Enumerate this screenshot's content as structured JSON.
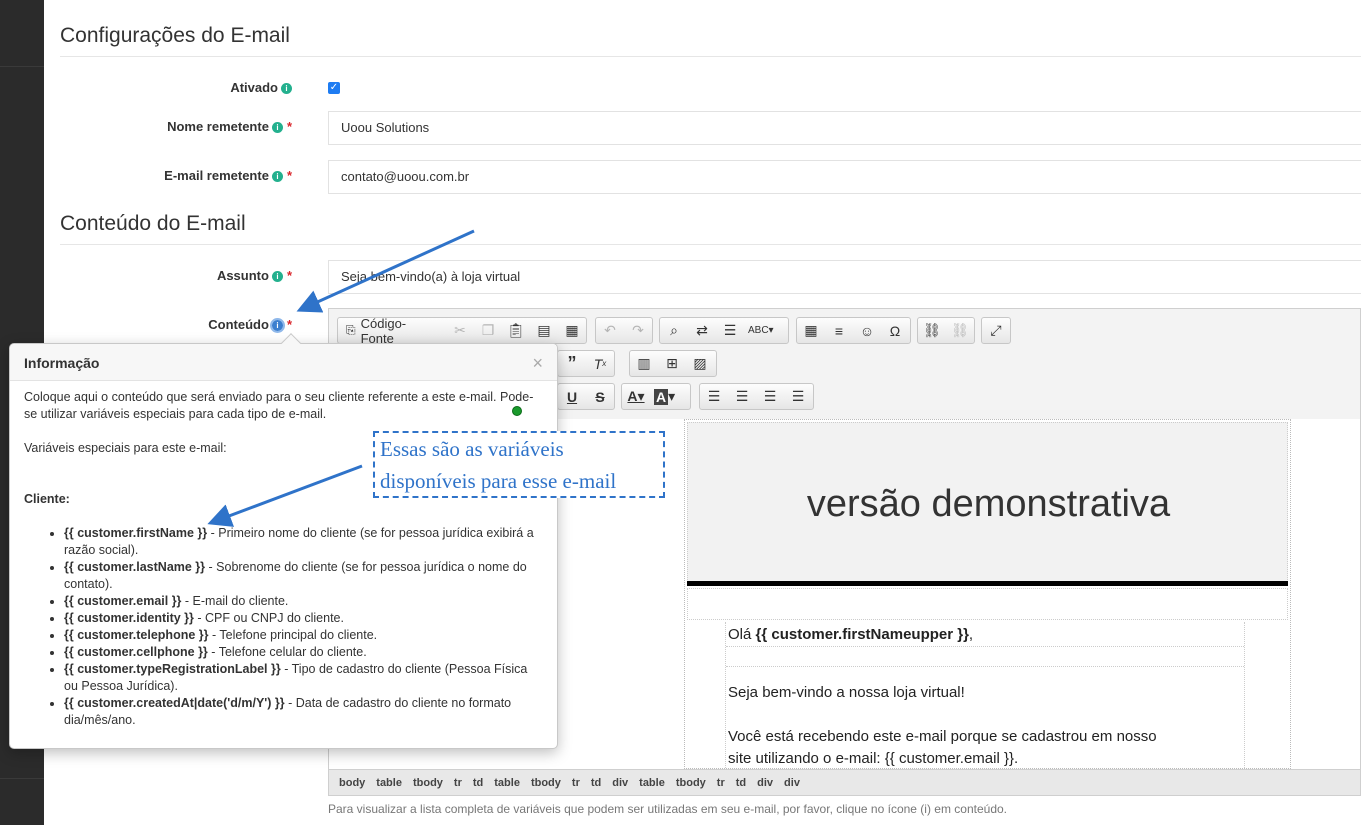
{
  "sections": {
    "config_title": "Configurações do E-mail",
    "content_title": "Conteúdo do E-mail"
  },
  "fields": {
    "enabled_label": "Ativado",
    "enabled_checked": true,
    "sender_name_label": "Nome remetente",
    "sender_name_value": "Uoou Solutions",
    "sender_email_label": "E-mail remetente",
    "sender_email_value": "contato@uoou.com.br",
    "subject_label": "Assunto",
    "subject_value": "Seja bem-vindo(a) à loja virtual",
    "content_label": "Conteúdo",
    "required_mark": "*",
    "info_glyph": "i"
  },
  "editor": {
    "source_button": "Código-Fonte",
    "toolbar_icons": [
      "source-icon",
      "cut-icon",
      "copy-icon",
      "paste-icon",
      "paste-text-icon",
      "paste-word-icon",
      "undo-icon",
      "redo-icon",
      "find-icon",
      "replace-icon",
      "select-all-icon",
      "spellcheck-icon",
      "table-icon",
      "horizontal-line-icon",
      "smiley-icon",
      "special-char-icon",
      "link-icon",
      "unlink-icon",
      "maximize-icon",
      "blockquote-icon",
      "remove-format-icon",
      "media-icon",
      "template-icon",
      "image-icon",
      "underline-icon",
      "strikethrough-icon",
      "text-color-icon",
      "bg-color-icon",
      "align-left-icon",
      "align-center-icon",
      "align-right-icon",
      "justify-icon"
    ],
    "brand_text": "versão demonstrativa",
    "greeting_prefix": "Olá ",
    "greeting_var": "{{ customer.firstNameupper }}",
    "greeting_suffix": ",",
    "welcome_line": "Seja bem-vindo a nossa loja virtual!",
    "body_line1": "Você está recebendo este e-mail porque se cadastrou em nosso",
    "body_line2_prefix": "site utilizando o e-mail: {{ ",
    "body_line2_var": "customer.email",
    "body_line2_suffix": " }}.",
    "path": [
      "body",
      "table",
      "tbody",
      "tr",
      "td",
      "table",
      "tbody",
      "tr",
      "td",
      "div",
      "table",
      "tbody",
      "tr",
      "td",
      "div",
      "div"
    ],
    "help_text": "Para visualizar a lista completa de variáveis que podem ser utilizadas em seu e-mail, por favor, clique no ícone (i) em conteúdo."
  },
  "popover": {
    "title": "Informação",
    "close": "×",
    "intro": "Coloque aqui o conteúdo que será enviado para o seu cliente referente a este e-mail. Pode-se utilizar variáveis especiais para cada tipo de e-mail.",
    "vars_heading": "Variáveis especiais para este e-mail:",
    "group_title": "Cliente:",
    "items": [
      {
        "var": "{{ customer.firstName }}",
        "desc": " - Primeiro nome do cliente (se for pessoa jurídica exibirá a razão social)."
      },
      {
        "var": "{{ customer.lastName }}",
        "desc": " - Sobrenome do cliente (se for pessoa jurídica o nome do contato)."
      },
      {
        "var": "{{ customer.email }}",
        "desc": " - E-mail do cliente."
      },
      {
        "var": "{{ customer.identity }}",
        "desc": " - CPF ou CNPJ do cliente."
      },
      {
        "var": "{{ customer.telephone }}",
        "desc": " - Telefone principal do cliente."
      },
      {
        "var": "{{ customer.cellphone }}",
        "desc": " - Telefone celular do cliente."
      },
      {
        "var": "{{ customer.typeRegistrationLabel }}",
        "desc": " - Tipo de cadastro do cliente (Pessoa Física ou Pessoa Jurídica)."
      },
      {
        "var": "{{ customer.createdAt|date('d/m/Y') }}",
        "desc": " - Data de cadastro do cliente no formato dia/mês/ano."
      }
    ]
  },
  "annotation": {
    "line1": "Essas são as variáveis",
    "line2": "disponíveis para esse e-mail",
    "color": "#2f73c9"
  },
  "colors": {
    "sidebar": "#2b2b2b",
    "info_icon": "#23b08e",
    "required": "#d9262c",
    "checkbox": "#1e7cf2"
  }
}
